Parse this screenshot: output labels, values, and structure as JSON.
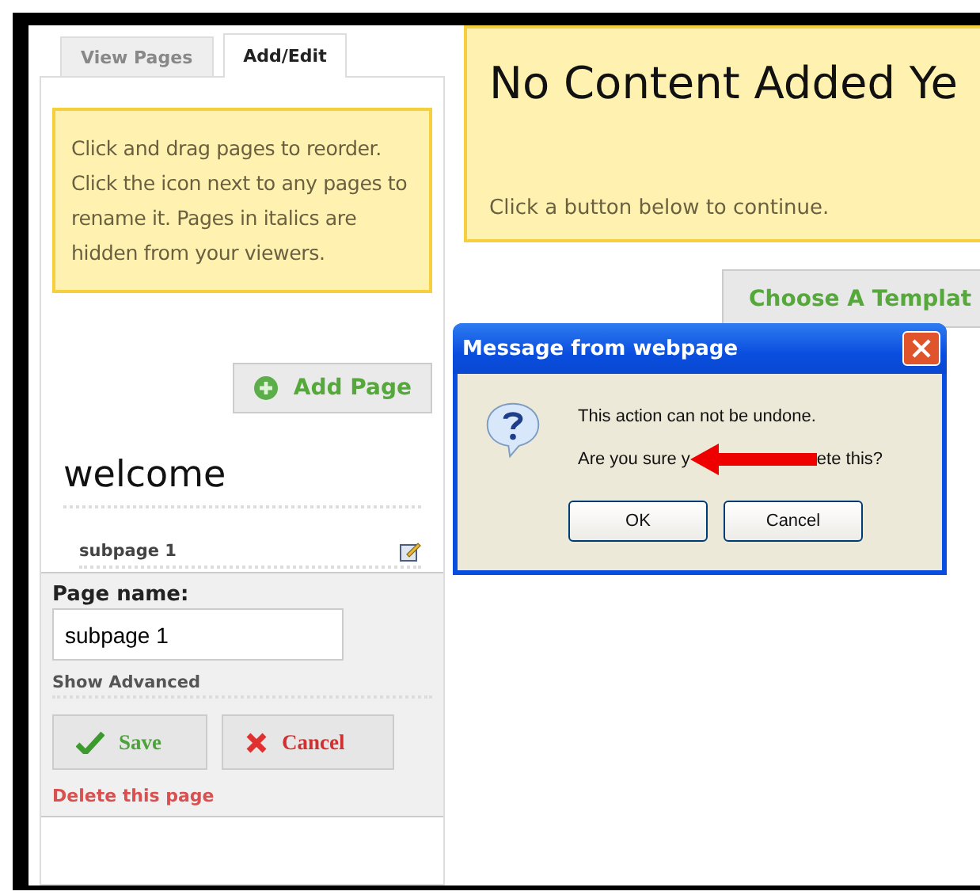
{
  "tabs": [
    {
      "label": "View Pages",
      "selected": false
    },
    {
      "label": "Add/Edit",
      "selected": true
    }
  ],
  "help_note": "Click and drag pages to reorder. Click the icon next to any pages to rename it. Pages in italics are hidden from your viewers.",
  "add_page_button": "Add Page",
  "pages": [
    {
      "name": "welcome",
      "kind": "page"
    },
    {
      "name": "subpage 1",
      "kind": "subpage"
    }
  ],
  "edit_form": {
    "label": "Page name:",
    "value": "subpage 1",
    "advanced_link": "Show Advanced",
    "save": "Save",
    "cancel": "Cancel",
    "delete_link": "Delete this page"
  },
  "content": {
    "title": "No Content Added Ye",
    "hint": "Click a button below to continue.",
    "template_button": "Choose A Templat"
  },
  "dialog": {
    "title": "Message from webpage",
    "line_1": "This action can not be undone.",
    "line_2_start": "Are you sure y",
    "line_2_end": "ete this?",
    "ok": "OK",
    "cancel": "Cancel"
  }
}
